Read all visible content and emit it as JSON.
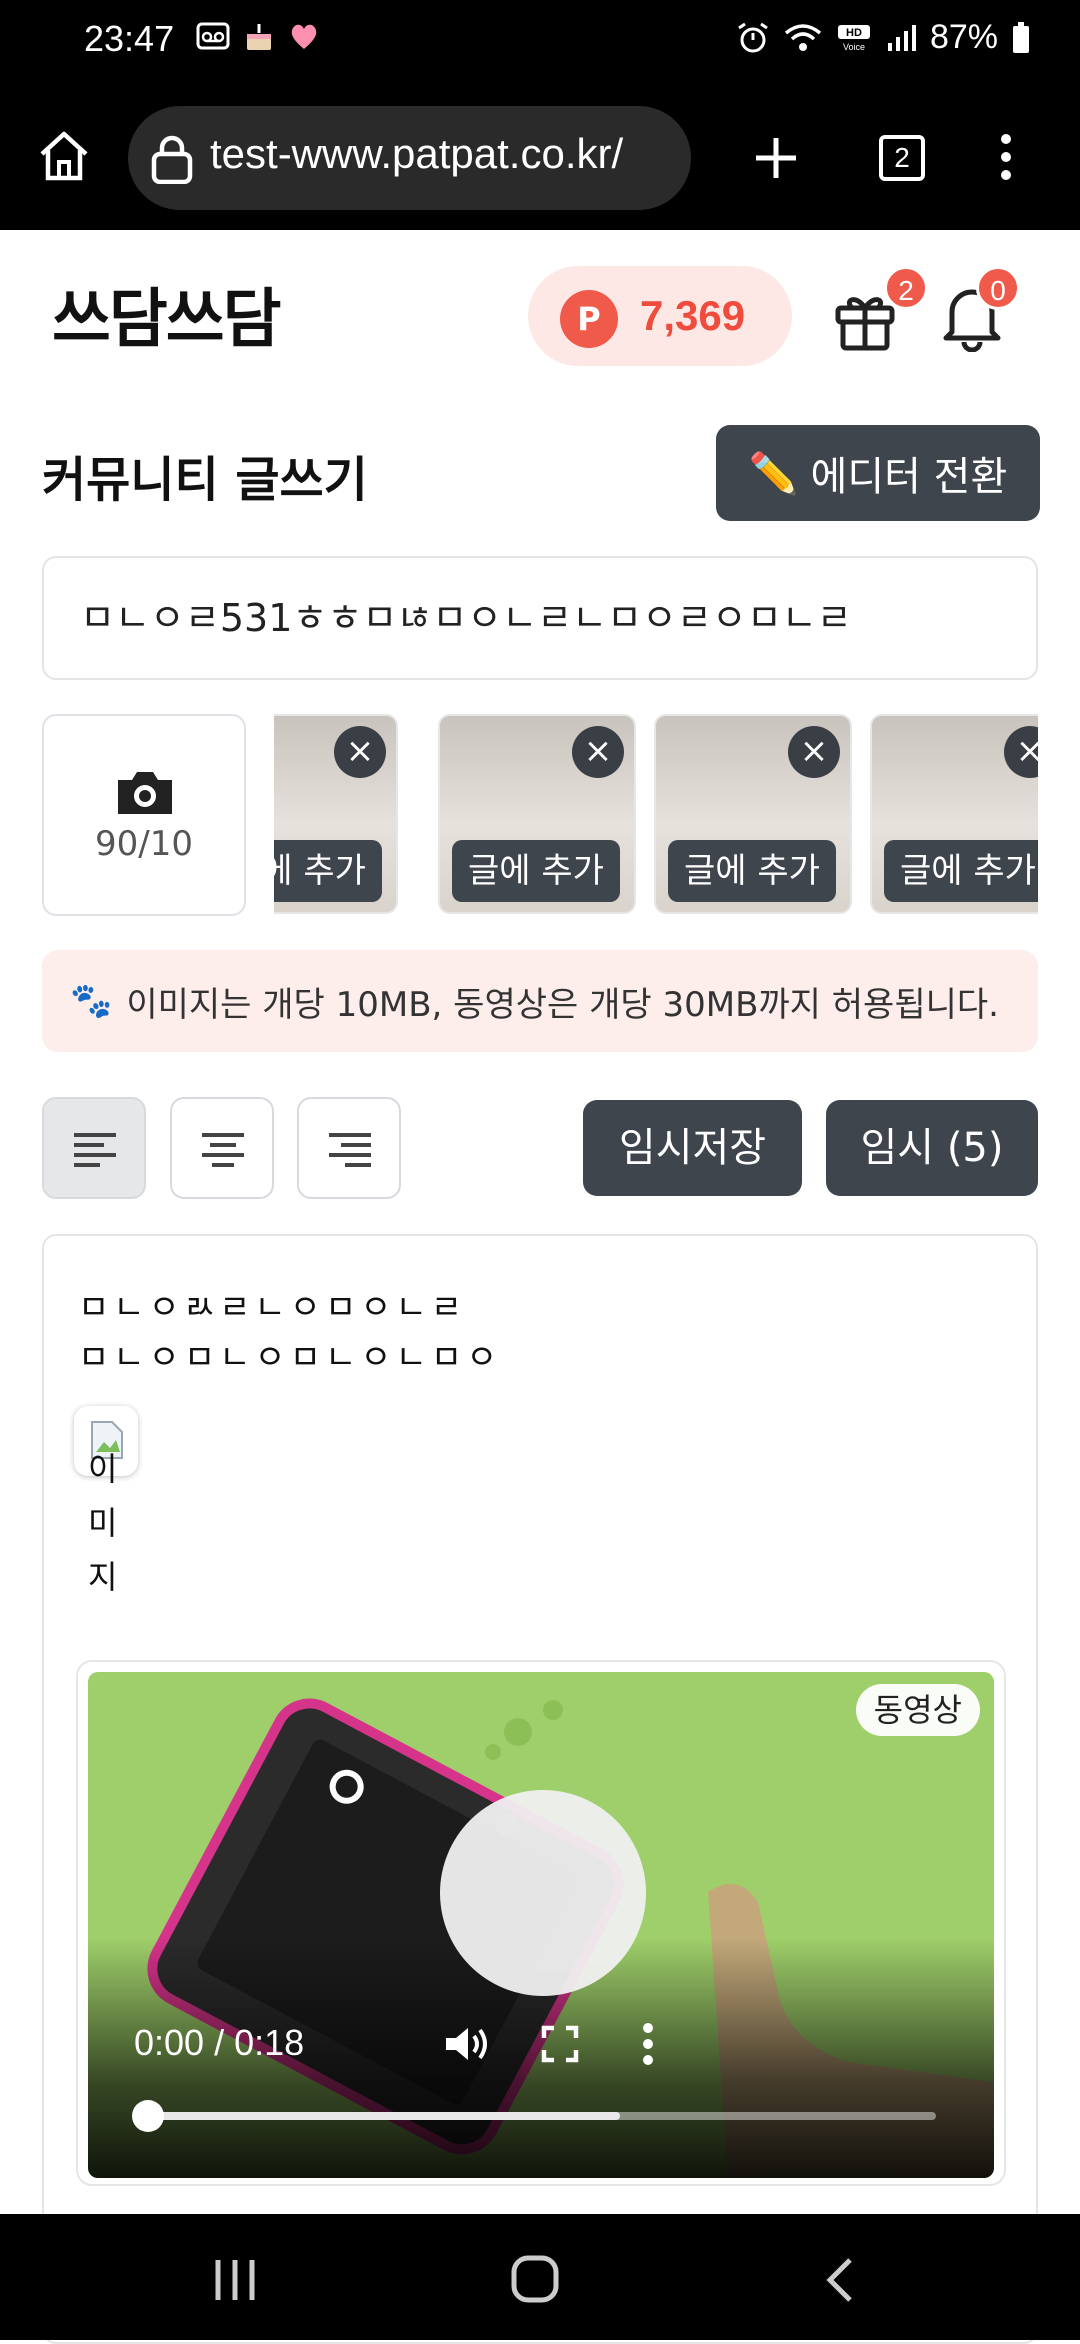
{
  "status_bar": {
    "time": "23:47",
    "battery": "87%",
    "left_icons": [
      "voicemail-icon",
      "cake-icon",
      "heart-icon"
    ],
    "right_icons": [
      "alarm-icon",
      "wifi-icon",
      "hd-voice-icon",
      "signal-icon",
      "battery-icon"
    ]
  },
  "browser": {
    "url": "test-www.patpat.co.kr/",
    "tab_count": "2"
  },
  "header": {
    "logo_text": "쓰담쓰담",
    "points_badge": "P",
    "points": "7,369",
    "gift_badge_count": "2",
    "notification_badge_count": "0"
  },
  "page": {
    "title": "커뮤니티 글쓰기",
    "editor_switch_label": "에디터 전환"
  },
  "title_field": {
    "value": "ㅁㄴㅇㄹ531ㅎㅎㅁㄶㅁㅇㄴㄹㄴㅁㅇㄹㅇㅁㄴㄹ"
  },
  "upload": {
    "count": "90/10",
    "thumbnails": [
      {
        "add_label": "글에 추가"
      },
      {
        "add_label": "글에 추가"
      },
      {
        "add_label": "글에 추가"
      },
      {
        "add_label": "글에 추가"
      }
    ]
  },
  "notice": {
    "text": "이미지는 개당 10MB, 동영상은 개당 30MB까지 허용됩니다."
  },
  "toolbar": {
    "temp_save_label": "임시저장",
    "temp_list_label": "임시 (5)"
  },
  "editor": {
    "lines": [
      "ㅁㄴㅇㄽㄹㄴㅇㅁㅇㄴㄹ",
      "ㅁㄴㅇㅁㄴㅇㅁㄴㅇㄴㅁㅇ"
    ],
    "broken_image_alt": "이미지",
    "video": {
      "tag": "동영상",
      "time": "0:00 / 0:18",
      "progress_fraction": 0.6
    }
  },
  "colors": {
    "accent": "#ef4c3d",
    "dark_button": "#3f454d",
    "notice_bg": "#fdeeec"
  }
}
